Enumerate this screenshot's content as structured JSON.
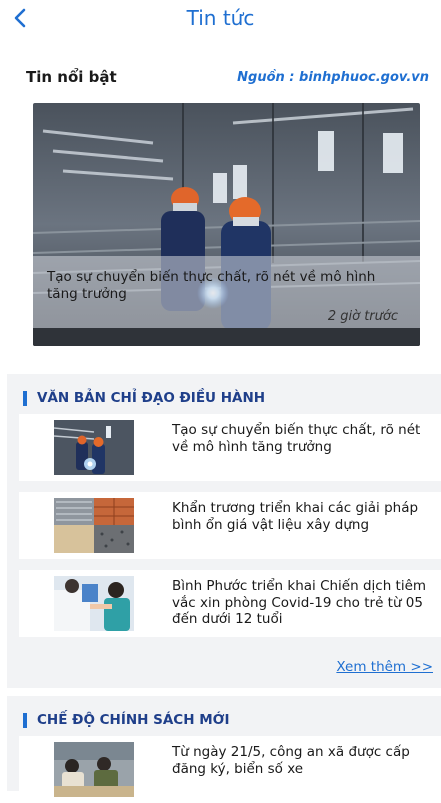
{
  "header": {
    "title": "Tin tức"
  },
  "featured": {
    "title": "Tin nổi bật",
    "source": "Nguồn : binhphuoc.gov.vn",
    "hero_caption": "Tạo sự chuyển biến thực chất, rõ nét về mô hình tăng trưởng",
    "hero_time": "2 giờ trước"
  },
  "sections": [
    {
      "title": "VĂN BẢN CHỈ ĐẠO ĐIỀU HÀNH",
      "items": [
        {
          "text": "Tạo sự chuyển biến thực chất, rõ nét về mô hình tăng trưởng",
          "image": "welding-workers-image"
        },
        {
          "text": "Khẩn trương triển khai các giải pháp bình ổn giá vật liệu xây dựng",
          "image": "construction-materials-image"
        },
        {
          "text": "Bình Phước triển khai Chiến dịch tiêm vắc xin phòng Covid-19 cho trẻ từ 05 đến dưới 12 tuổi",
          "image": "vaccination-image"
        }
      ],
      "more_label": "Xem thêm >>"
    },
    {
      "title": "CHẾ ĐỘ CHÍNH SÁCH MỚI",
      "items": [
        {
          "text": "Từ ngày 21/5, công an xã được cấp đăng ký, biển số xe",
          "image": "police-office-image"
        }
      ]
    }
  ],
  "colors": {
    "accent": "#1f6fd1",
    "section_title": "#1f3f8a",
    "section_bg": "#f2f3f5"
  },
  "icons": {
    "back": "chevron-left-icon",
    "section_marker": "section-bar-icon"
  }
}
